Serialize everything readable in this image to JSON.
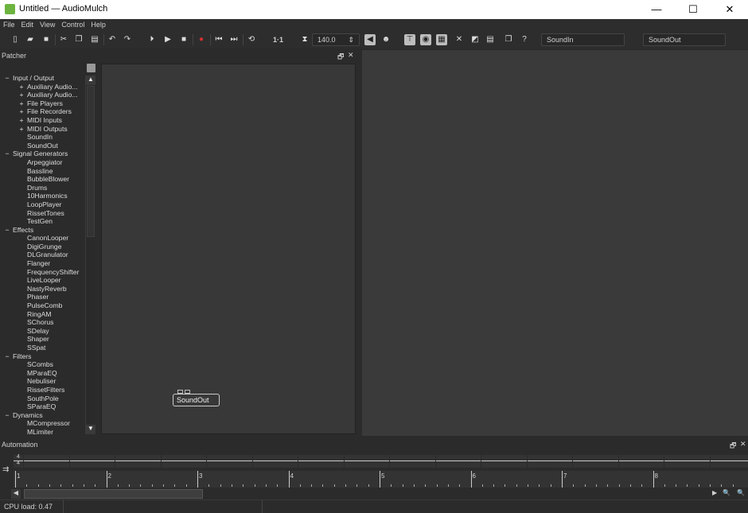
{
  "window": {
    "title": "Untitled — AudioMulch",
    "minimize": "—",
    "maximize": "☐",
    "close": "✕"
  },
  "menu": [
    "File",
    "Edit",
    "View",
    "Control",
    "Help"
  ],
  "toolbar": {
    "position": "1·1",
    "tempo": "140.0",
    "sound_in": "SoundIn",
    "sound_out": "SoundOut",
    "icons": [
      "new-icon",
      "open-icon",
      "save-icon",
      "cut-icon",
      "copy-icon",
      "paste-icon",
      "undo-icon",
      "redo-icon",
      "play-from-start-icon",
      "play-icon",
      "stop-icon",
      "record-icon",
      "skip-start-icon",
      "skip-end-icon",
      "loop-icon"
    ],
    "record_color": "#d03030"
  },
  "patcher": {
    "title": "Patcher",
    "float": "🗗",
    "close": "✕",
    "tree": [
      {
        "label": "Input / Output",
        "level": 0,
        "toggle": "−"
      },
      {
        "label": "Auxiliary Audio...",
        "level": 1,
        "toggle": "+"
      },
      {
        "label": "Auxiliary Audio...",
        "level": 1,
        "toggle": "+"
      },
      {
        "label": "File Players",
        "level": 1,
        "toggle": "+"
      },
      {
        "label": "File Recorders",
        "level": 1,
        "toggle": "+"
      },
      {
        "label": "MIDI Inputs",
        "level": 1,
        "toggle": "+"
      },
      {
        "label": "MIDI Outputs",
        "level": 1,
        "toggle": "+"
      },
      {
        "label": "SoundIn",
        "level": 1,
        "toggle": ""
      },
      {
        "label": "SoundOut",
        "level": 1,
        "toggle": ""
      },
      {
        "label": "Signal Generators",
        "level": 0,
        "toggle": "−"
      },
      {
        "label": "Arpeggiator",
        "level": 1,
        "toggle": ""
      },
      {
        "label": "Bassline",
        "level": 1,
        "toggle": ""
      },
      {
        "label": "BubbleBlower",
        "level": 1,
        "toggle": ""
      },
      {
        "label": "Drums",
        "level": 1,
        "toggle": ""
      },
      {
        "label": "10Harmonics",
        "level": 1,
        "toggle": ""
      },
      {
        "label": "LoopPlayer",
        "level": 1,
        "toggle": ""
      },
      {
        "label": "RissetTones",
        "level": 1,
        "toggle": ""
      },
      {
        "label": "TestGen",
        "level": 1,
        "toggle": ""
      },
      {
        "label": "Effects",
        "level": 0,
        "toggle": "−"
      },
      {
        "label": "CanonLooper",
        "level": 1,
        "toggle": ""
      },
      {
        "label": "DigiGrunge",
        "level": 1,
        "toggle": ""
      },
      {
        "label": "DLGranulator",
        "level": 1,
        "toggle": ""
      },
      {
        "label": "Flanger",
        "level": 1,
        "toggle": ""
      },
      {
        "label": "FrequencyShifter",
        "level": 1,
        "toggle": ""
      },
      {
        "label": "LiveLooper",
        "level": 1,
        "toggle": ""
      },
      {
        "label": "NastyReverb",
        "level": 1,
        "toggle": ""
      },
      {
        "label": "Phaser",
        "level": 1,
        "toggle": ""
      },
      {
        "label": "PulseComb",
        "level": 1,
        "toggle": ""
      },
      {
        "label": "RingAM",
        "level": 1,
        "toggle": ""
      },
      {
        "label": "SChorus",
        "level": 1,
        "toggle": ""
      },
      {
        "label": "SDelay",
        "level": 1,
        "toggle": ""
      },
      {
        "label": "Shaper",
        "level": 1,
        "toggle": ""
      },
      {
        "label": "SSpat",
        "level": 1,
        "toggle": ""
      },
      {
        "label": "Filters",
        "level": 0,
        "toggle": "−"
      },
      {
        "label": "SCombs",
        "level": 1,
        "toggle": ""
      },
      {
        "label": "MParaEQ",
        "level": 1,
        "toggle": ""
      },
      {
        "label": "Nebuliser",
        "level": 1,
        "toggle": ""
      },
      {
        "label": "RissetFilters",
        "level": 1,
        "toggle": ""
      },
      {
        "label": "SouthPole",
        "level": 1,
        "toggle": ""
      },
      {
        "label": "SParaEQ",
        "level": 1,
        "toggle": ""
      },
      {
        "label": "Dynamics",
        "level": 0,
        "toggle": "−"
      },
      {
        "label": "MCompressor",
        "level": 1,
        "toggle": ""
      },
      {
        "label": "MLimiter",
        "level": 1,
        "toggle": ""
      }
    ],
    "node": "SoundOut"
  },
  "automation": {
    "title": "Automation",
    "time_signature_top": "4",
    "time_signature_bottom": "4",
    "bars": [
      "1",
      "2",
      "3",
      "4",
      "5",
      "6",
      "7",
      "8"
    ]
  },
  "status": {
    "cpu": "CPU load: 0.47"
  }
}
